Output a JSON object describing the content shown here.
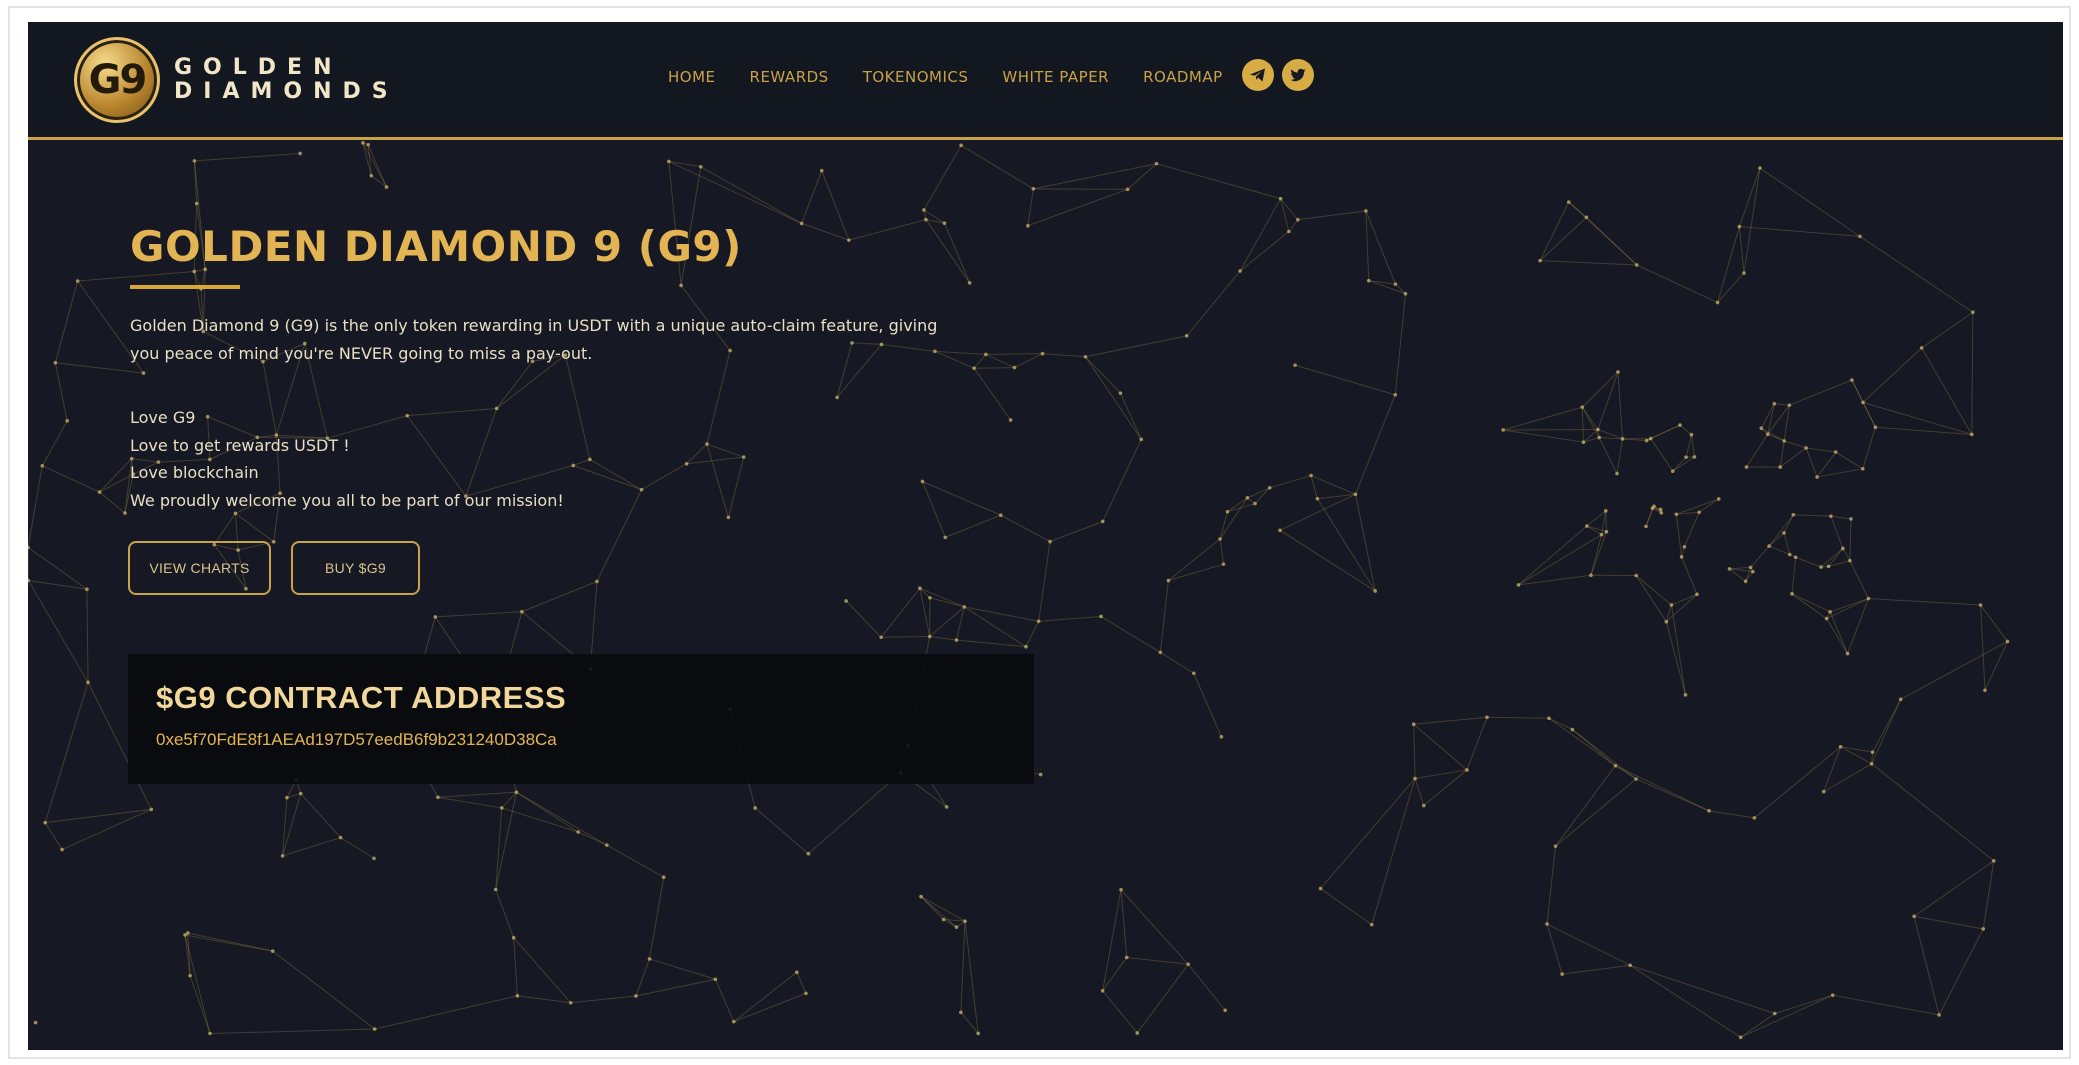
{
  "header": {
    "logo_badge": "G9",
    "logo_line1": "GOLDEN",
    "logo_line2": "DIAMONDS",
    "nav": [
      "HOME",
      "REWARDS",
      "TOKENOMICS",
      "WHITE PAPER",
      "ROADMAP"
    ],
    "socials": [
      {
        "icon": "telegram-icon"
      },
      {
        "icon": "twitter-icon"
      }
    ]
  },
  "hero": {
    "title": "GOLDEN DIAMOND 9 (G9)",
    "description_line1": "Golden Diamond 9 (G9) is the only token rewarding in USDT with a unique auto-claim feature, giving",
    "description_line2": "you peace of mind you're NEVER going to miss a pay-out.",
    "lines": [
      "Love G9",
      "Love to get rewards USDT !",
      "Love blockchain",
      "We proudly welcome you all to be part of our mission!"
    ],
    "buttons": {
      "view_charts": "VIEW CHARTS",
      "buy": "BUY $G9"
    }
  },
  "contract": {
    "title": "$G9 CONTRACT ADDRESS",
    "address": "0xe5f70FdE8f1AEAd197D57eedB6f9b231240D38Ca"
  },
  "colors": {
    "background": "#161923",
    "accent_gold": "#c9a24a",
    "title_gold": "#e2b453",
    "text": "#e8dfc4"
  }
}
